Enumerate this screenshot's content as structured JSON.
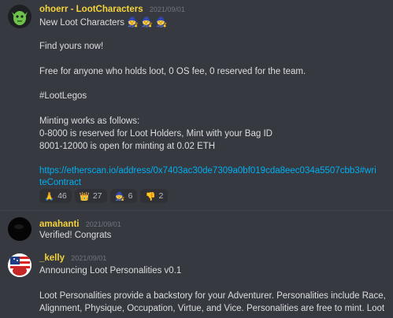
{
  "messages": [
    {
      "author": "ohoerr - LootCharacters",
      "author_color": "#f5d33b",
      "timestamp": "2021/09/01",
      "lines": [
        "New Loot Characters",
        "Find yours now!",
        "Free for anyone who holds loot, 0 OS fee, 0 reserved for the team.",
        "#LootLegos",
        "Minting works as follows:",
        "0-8000 is reserved for Loot Holders, Mint with your Bag ID",
        "8001-12000 is open for minting at 0.02 ETH"
      ],
      "link_line1": "https://etherscan.io/address/0x7403ac30de7309a0bf019cda8eec034a5507cbb3#wri",
      "link_line2": "teContract",
      "title_emojis": [
        "wizard-icon",
        "wizard-icon",
        "wizard-icon"
      ],
      "reactions": [
        {
          "icon": "pray-icon",
          "glyph": "🙏",
          "count": "46"
        },
        {
          "icon": "crown-icon",
          "glyph": "👑",
          "count": "27"
        },
        {
          "icon": "wizard-icon",
          "glyph": "🧙",
          "count": "6"
        },
        {
          "icon": "thumbs-down-icon",
          "glyph": "👎",
          "count": "2"
        }
      ]
    },
    {
      "author": "amahanti",
      "author_color": "#f5d33b",
      "timestamp": "2021/09/01",
      "lines": [
        "Verified! Congrats"
      ]
    },
    {
      "author": "_kelly",
      "author_color": "#f5d33b",
      "timestamp": "2021/09/01",
      "lines": [
        "Announcing Loot Personalities v0.1",
        "Loot Personalities provide a backstory for your Adventurer. Personalities include Race,",
        "Alignment, Physique, Occupation, Virtue, and Vice. Personalities are free to mint. Loot"
      ]
    }
  ]
}
